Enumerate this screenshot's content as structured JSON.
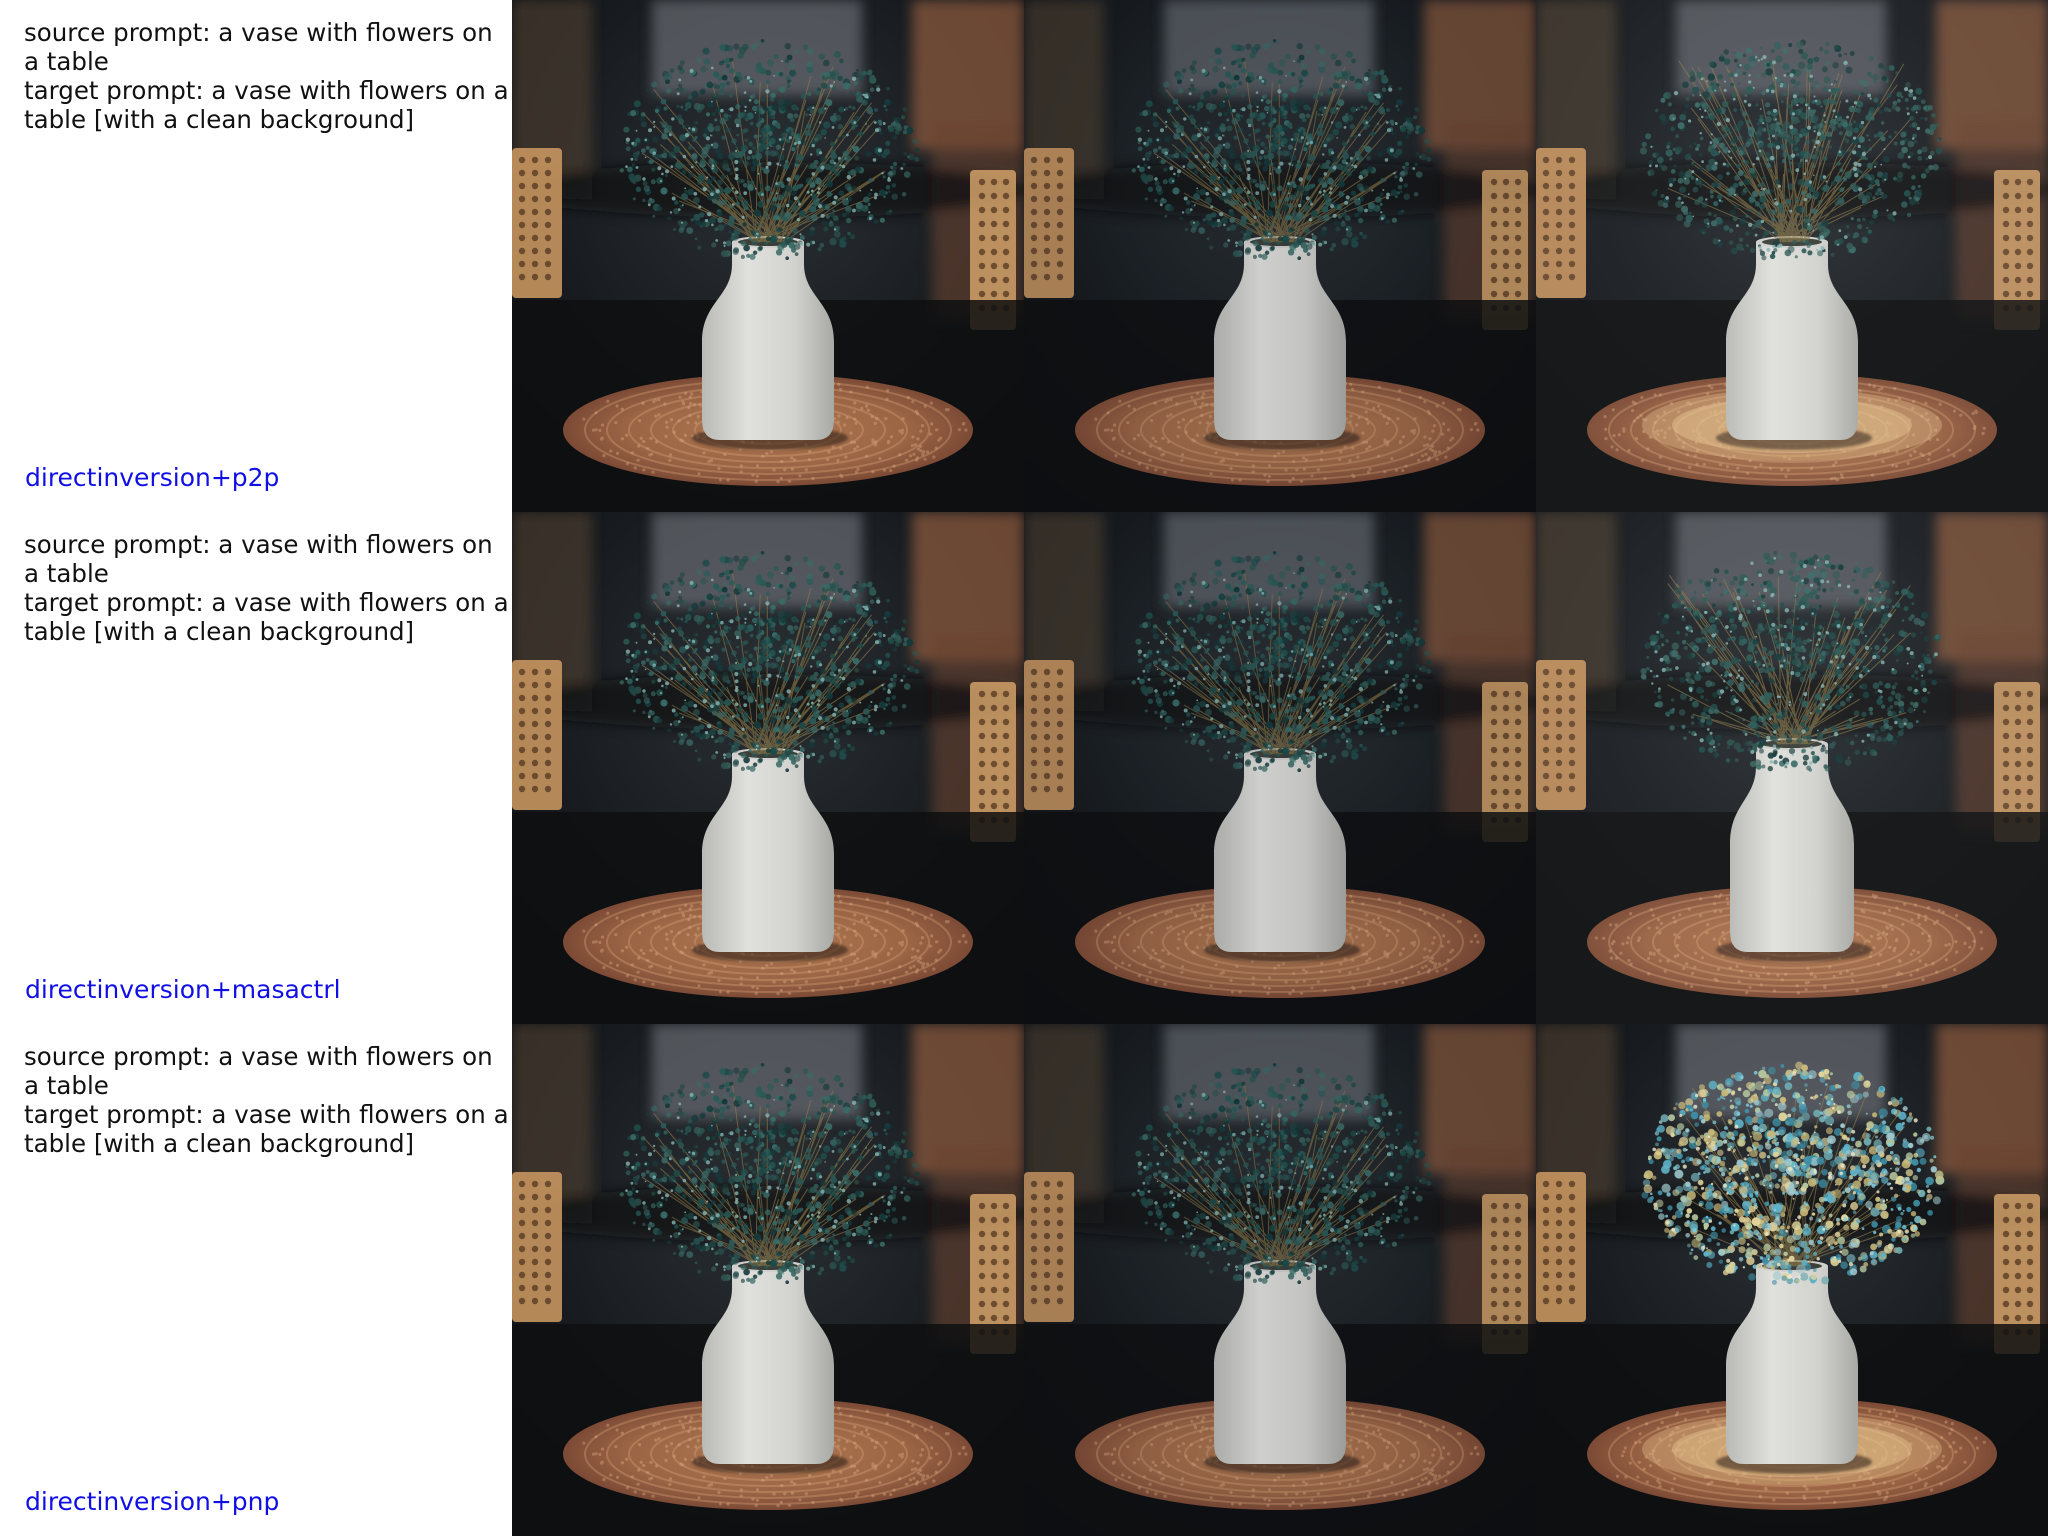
{
  "colors": {
    "method_label": "#1010e6",
    "prompt_text": "#111111",
    "background": "#ffffff"
  },
  "rows": [
    {
      "source_prompt": "source prompt: a vase with flowers on a table",
      "target_prompt": "target prompt: a vase with flowers on a table [with a clean background]",
      "method": "directinversion+p2p",
      "images": [
        "source",
        "reconstruction",
        "edited"
      ]
    },
    {
      "source_prompt": "source prompt: a vase with flowers on a table",
      "target_prompt": "target prompt: a vase with flowers on a table [with a clean background]",
      "method": "directinversion+masactrl",
      "images": [
        "source",
        "reconstruction",
        "edited"
      ]
    },
    {
      "source_prompt": "source prompt: a vase with flowers on a table",
      "target_prompt": "target prompt: a vase with flowers on a table [with a clean background]",
      "method": "directinversion+pnp",
      "images": [
        "source",
        "reconstruction",
        "edited"
      ]
    }
  ]
}
